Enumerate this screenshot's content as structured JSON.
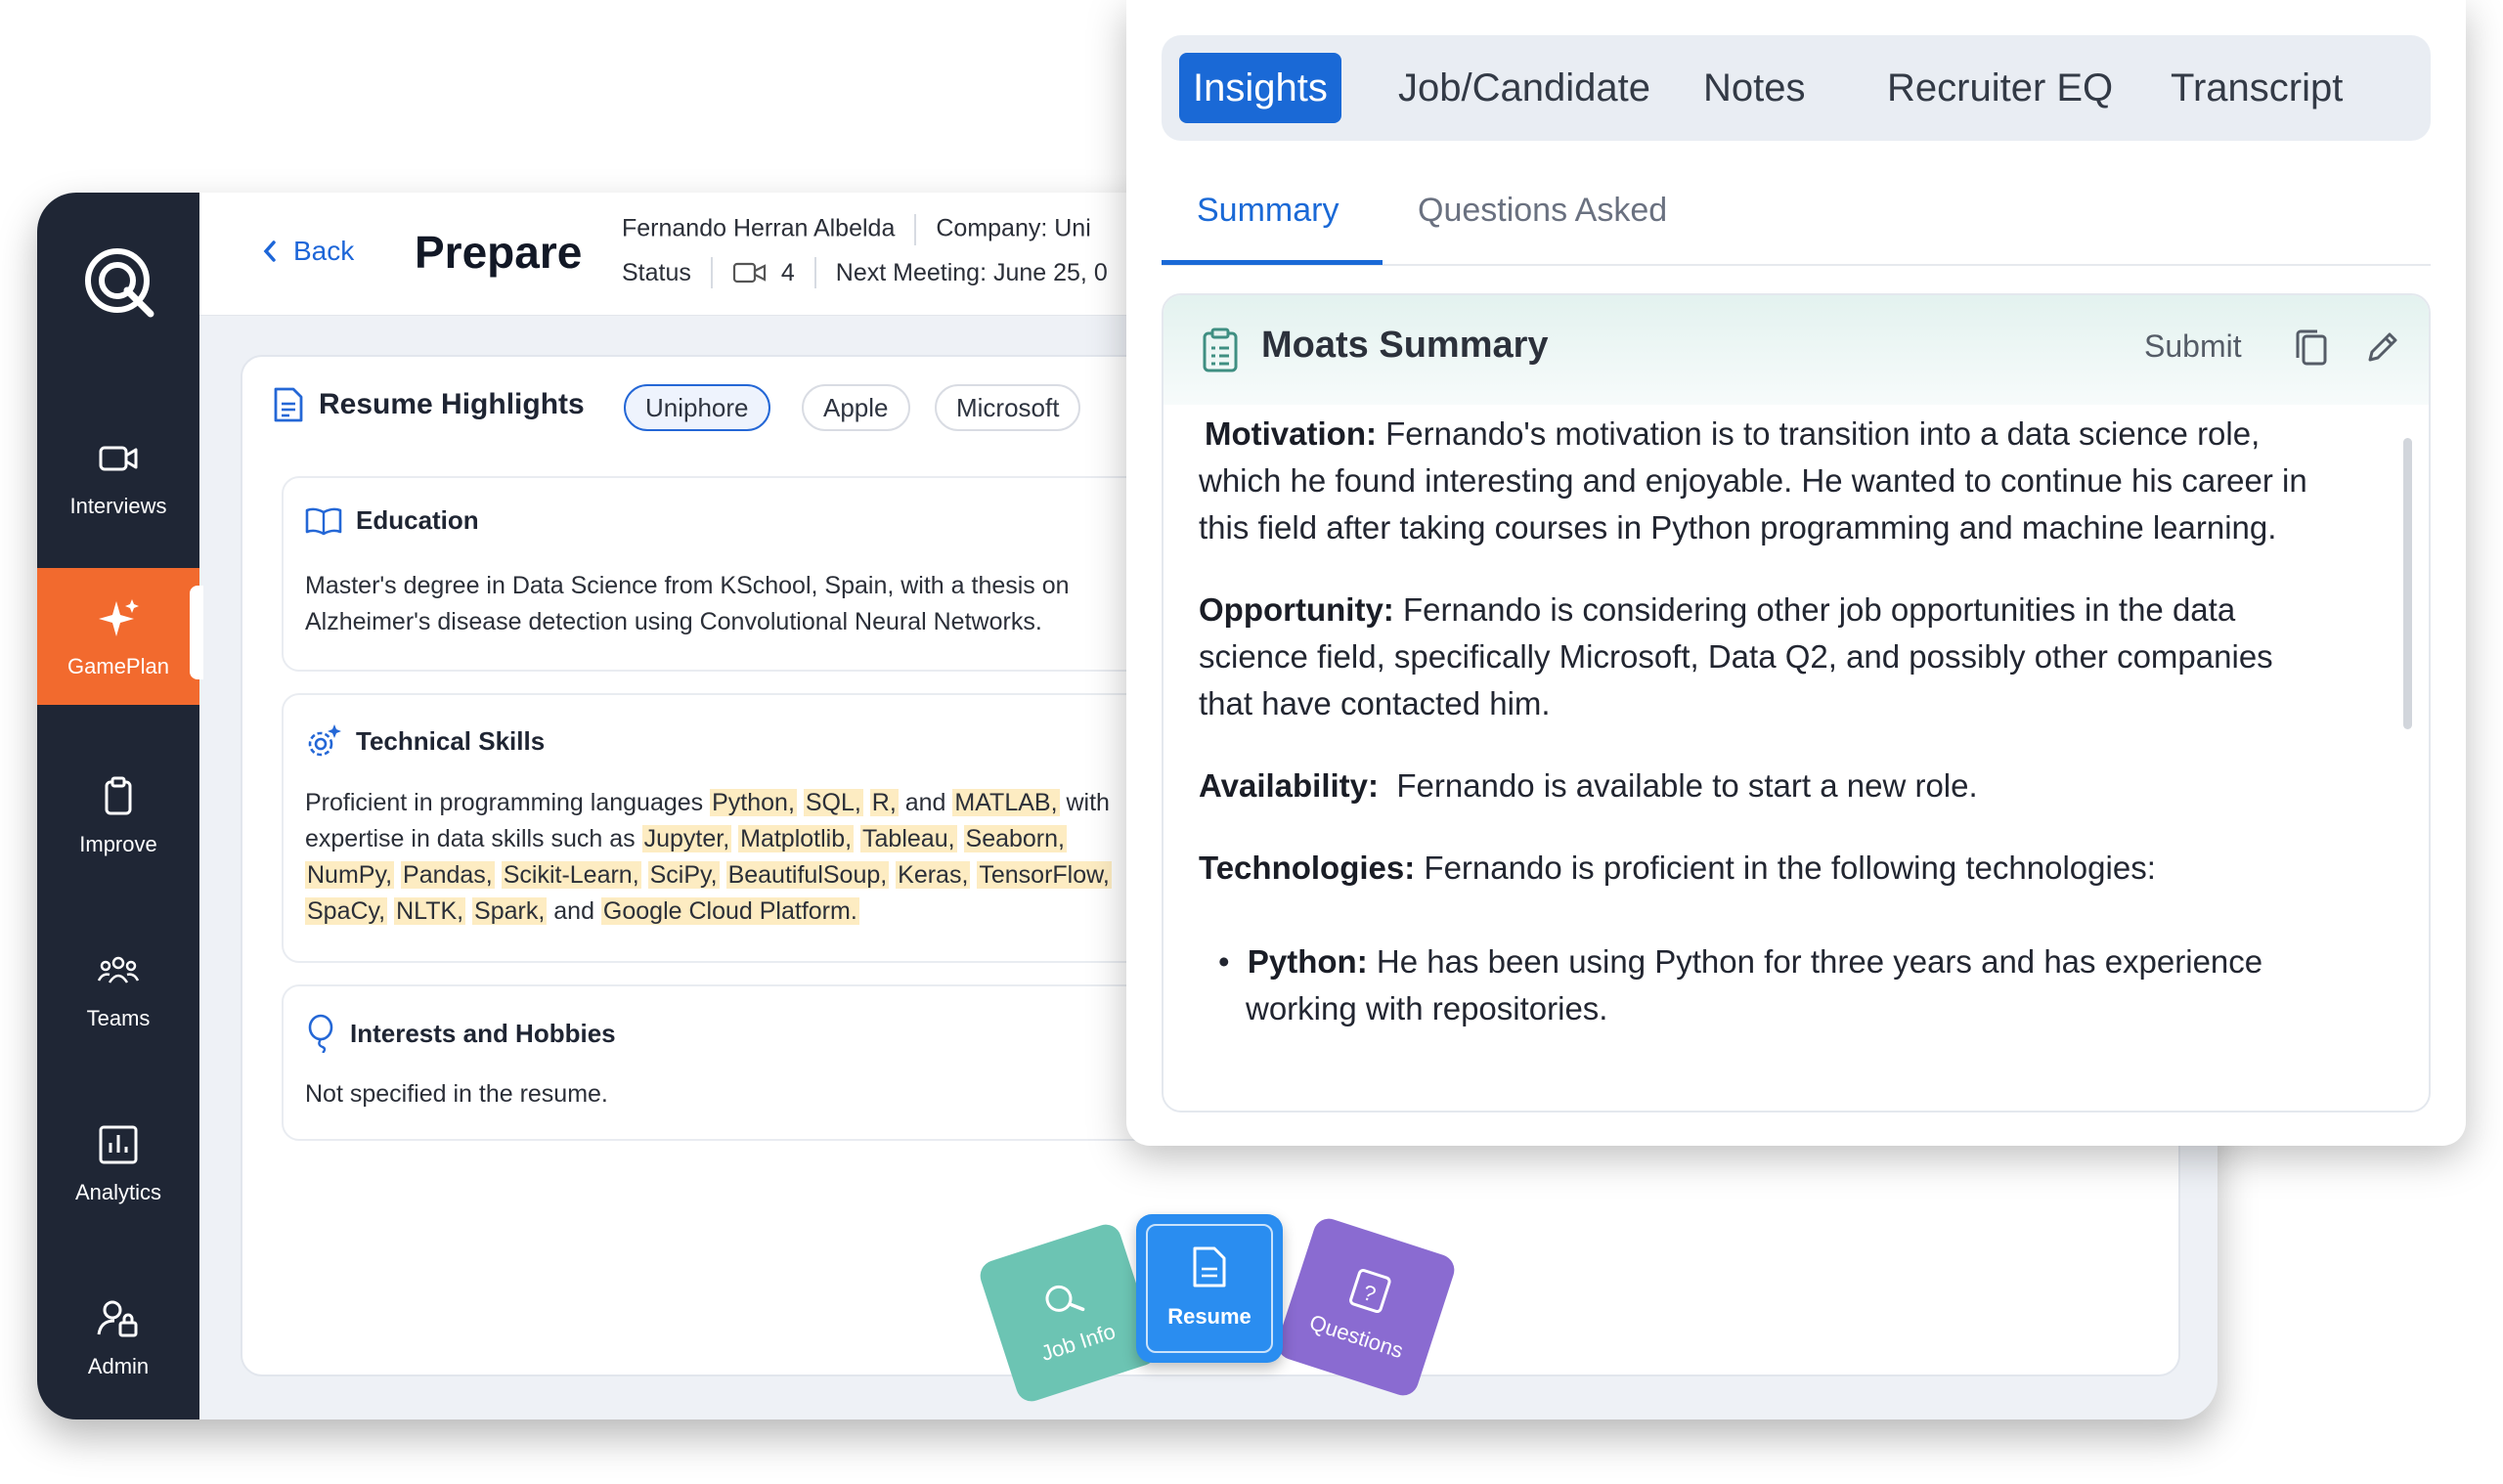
{
  "sidebar": {
    "items": [
      {
        "label": "Interviews",
        "icon": "video-camera-icon"
      },
      {
        "label": "GamePlan",
        "icon": "sparkle-icon"
      },
      {
        "label": "Improve",
        "icon": "clipboard-icon"
      },
      {
        "label": "Teams",
        "icon": "people-group-icon"
      },
      {
        "label": "Analytics",
        "icon": "bar-chart-icon"
      },
      {
        "label": "Admin",
        "icon": "user-lock-icon"
      }
    ],
    "active_color": "#f26a2e"
  },
  "header": {
    "back_label": "Back",
    "title": "Prepare",
    "candidate_name": "Fernando Herran Albelda",
    "company": "Company: Uni",
    "status": "Status",
    "video_count": "4",
    "next_meeting": "Next Meeting: June 25, 0"
  },
  "resume": {
    "title": "Resume Highlights",
    "chips": [
      "Uniphore",
      "Apple",
      "Microsoft"
    ],
    "education": {
      "title": "Education",
      "line1": "Master's degree in Data Science from KSchool, Spain, with a thesis on",
      "line2": "Alzheimer's disease detection using Convolutional Neural Networks."
    },
    "skills": {
      "title": "Technical Skills",
      "t1": "Proficient in programming languages ",
      "python": "Python,",
      "sql": "SQL,",
      "r": "R,",
      "and1": " and ",
      "matlab": "MATLAB,",
      "with": " with",
      "t2": "expertise in data skills such as ",
      "jupyter": "Jupyter,",
      "matplotlib": "Matplotlib,",
      "tableau": "Tableau,",
      "seaborn": "Seaborn,",
      "numpy": "NumPy,",
      "pandas": "Pandas,",
      "sklearn": "Scikit-Learn,",
      "scipy": "SciPy,",
      "bs": "BeautifulSoup,",
      "keras": "Keras,",
      "tf": "TensorFlow,",
      "spacy": "SpaCy,",
      "nltk": "NLTK,",
      "spark": "Spark,",
      "and2": " and ",
      "gcp": "Google Cloud Platform."
    },
    "interests": {
      "title": "Interests and Hobbies",
      "text": "Not specified in the resume."
    }
  },
  "deck": {
    "job_info": "Job Info",
    "resume": "Resume",
    "questions": "Questions"
  },
  "panel": {
    "tabs": [
      "Insights",
      "Job/Candidate",
      "Notes",
      "Recruiter EQ",
      "Transcript"
    ],
    "subtabs": [
      "Summary",
      "Questions Asked"
    ],
    "summary_title": "Moats Summary",
    "submit_label": "Submit",
    "motivation_label": "Motivation:",
    "motivation_1": " Fernando's motivation is to transition into a data science role,",
    "motivation_2": "which he found interesting and enjoyable. He wanted to continue his career in",
    "motivation_3": "this field after taking courses in Python programming and machine learning.",
    "opportunity_label": "Opportunity:",
    "opportunity_1": " Fernando is considering other job opportunities in the data",
    "opportunity_2": "science field, specifically Microsoft, Data Q2, and possibly other companies",
    "opportunity_3": "that have contacted him.",
    "availability_label": "Availability:",
    "availability_text": "  Fernando is available to start a new role.",
    "technologies_label": "Technologies:",
    "technologies_text": " Fernando is proficient in the following technologies:",
    "python_label": "Python:",
    "python_1": " He has been using Python for three years and has experience",
    "python_2": "working with repositories."
  },
  "colors": {
    "sidebar_bg": "#1f2635",
    "accent_blue": "#1a69d6",
    "job_card": "#6cc4b3",
    "resume_card": "#2a8df0",
    "questions_card": "#8a6bd1",
    "highlight": "#fdecc2"
  }
}
